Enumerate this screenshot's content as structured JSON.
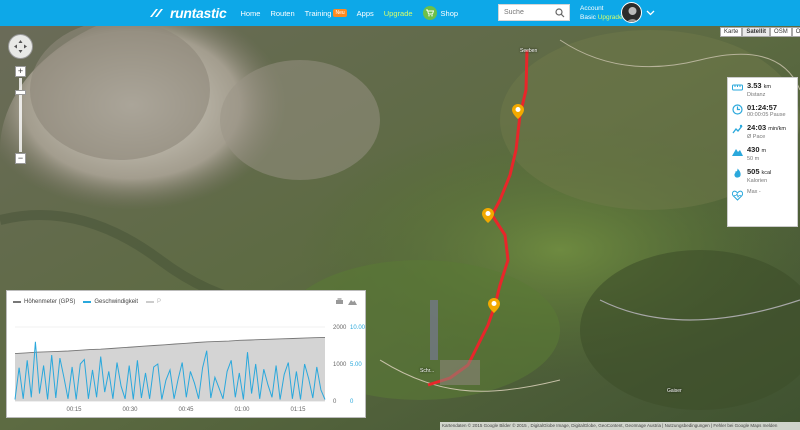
{
  "nav": {
    "logo": "runtastic",
    "items": [
      {
        "label": "Home"
      },
      {
        "label": "Routen"
      },
      {
        "label": "Training",
        "badge": "Neu"
      },
      {
        "label": "Apps"
      },
      {
        "label": "Upgrade"
      },
      {
        "label": "Shop"
      }
    ],
    "search_placeholder": "Suche",
    "account_label": "Account",
    "account_plan": "Basic",
    "account_upgrade": "Upgrade"
  },
  "map": {
    "layers": [
      "Karte",
      "Satellit",
      "OSM",
      "OCM"
    ],
    "active_layer": "Satellit",
    "labels": [
      "Seeben",
      "Schr...",
      "Gaiser"
    ],
    "attribution": "Kartendaten © 2015 Google Bilder © 2015 , DigitalGlobe Image, DigitalGlobe, GeoContent, GeoImage Austria | Nutzungsbedingungen | Fehler bei Google Maps melden"
  },
  "stats": [
    {
      "icon": "distance-icon",
      "value": "3.53",
      "unit": "km",
      "sub": "Distanz"
    },
    {
      "icon": "clock-icon",
      "value": "01:24:57",
      "unit": "",
      "sub": "00:00:05 Pause"
    },
    {
      "icon": "runner-icon",
      "value": "24:03",
      "unit": "min/km",
      "sub": "Ø Pace"
    },
    {
      "icon": "mountain-icon",
      "value": "430",
      "unit": "m",
      "sub": "50 m"
    },
    {
      "icon": "flame-icon",
      "value": "505",
      "unit": "kcal",
      "sub": "Kalorien"
    },
    {
      "icon": "heart-icon",
      "value": "",
      "unit": "",
      "sub": "Max -"
    }
  ],
  "chart_data": {
    "type": "line",
    "legend": [
      "Höhenmeter (GPS)",
      "Geschwindigkeit",
      "P"
    ],
    "x_ticks": [
      "00:15",
      "00:30",
      "00:45",
      "01:00",
      "01:15"
    ],
    "y_left_ticks": [
      "2000",
      "1000",
      "0"
    ],
    "y_right_ticks": [
      "10.00",
      "5.00",
      "0"
    ],
    "ylim_elevation": [
      0,
      2000
    ],
    "ylim_speed": [
      0,
      10
    ],
    "series": [
      {
        "name": "Höhenmeter (GPS)",
        "color": "#777777",
        "values": [
          1280,
          1300,
          1320,
          1330,
          1340,
          1350,
          1370,
          1390,
          1400,
          1420,
          1440,
          1460,
          1480,
          1500,
          1520,
          1540,
          1560,
          1580,
          1600,
          1610,
          1620,
          1640,
          1650,
          1660,
          1670,
          1680,
          1690,
          1700,
          1710,
          1720
        ]
      },
      {
        "name": "Geschwindigkeit",
        "color": "#2aa8dc",
        "values": [
          0.2,
          4.5,
          0.3,
          5.5,
          0.5,
          8.0,
          1.0,
          4.8,
          0.2,
          6.2,
          0.4,
          5.8,
          3.2,
          0.3,
          4.6,
          0.2,
          5.0,
          5.6,
          0.3,
          4.2,
          0.5,
          6.0,
          1.2,
          4.0,
          0.3,
          5.2,
          2.0,
          0.3,
          4.8,
          0.2,
          5.5,
          0.4,
          3.8,
          0.3,
          4.6,
          5.0,
          0.2,
          2.8,
          4.2,
          0.3,
          3.0,
          5.2,
          0.5,
          4.0,
          2.4,
          0.3,
          4.5,
          6.8,
          0.4,
          3.2,
          1.8,
          0.3,
          4.0,
          5.5,
          0.5,
          3.8,
          0.2,
          6.6,
          1.0,
          5.0,
          0.3,
          4.3,
          2.2,
          0.5,
          4.8,
          0.2,
          3.6,
          5.2,
          0.3,
          4.0,
          0.2,
          5.0,
          3.0,
          0.4,
          4.6,
          1.5,
          0.2
        ]
      }
    ]
  }
}
